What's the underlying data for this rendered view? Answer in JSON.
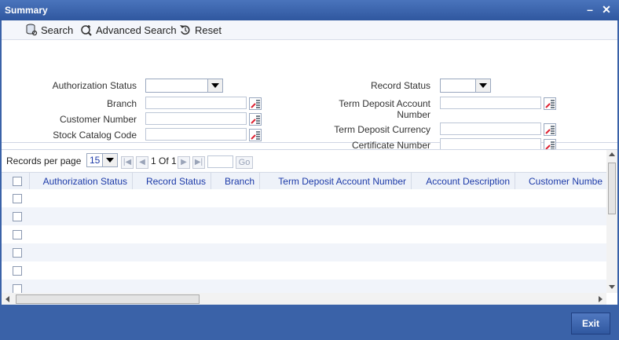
{
  "window": {
    "title": "Summary",
    "minimize_label": "–",
    "close_label": "✕"
  },
  "toolbar": {
    "search_label": "Search",
    "advanced_search_label": "Advanced Search",
    "reset_label": "Reset"
  },
  "criteria": {
    "authorization_status_label": "Authorization Status",
    "branch_label": "Branch",
    "customer_number_label": "Customer Number",
    "stock_catalog_code_label": "Stock Catalog Code",
    "record_status_label": "Record Status",
    "term_deposit_account_label_1": "Term Deposit Account",
    "term_deposit_account_label_2": "Number",
    "term_deposit_currency_label": "Term Deposit Currency",
    "certificate_number_label": "Certificate Number"
  },
  "pager": {
    "records_per_page_label": "Records per page",
    "records_per_page_value": "15",
    "page_info": "1 Of 1",
    "goto_value": "",
    "go_label": "Go"
  },
  "grid": {
    "columns": [
      "Authorization Status",
      "Record Status",
      "Branch",
      "Term Deposit Account Number",
      "Account Description",
      "Customer Numbe"
    ]
  },
  "footer": {
    "exit_label": "Exit"
  }
}
